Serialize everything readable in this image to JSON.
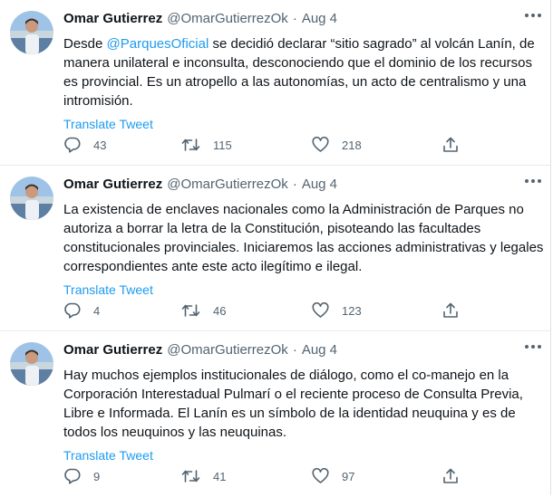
{
  "colors": {
    "accent": "#1d9bf0",
    "text": "#0f1419",
    "secondary": "#536471"
  },
  "icons": {
    "reply": "reply-icon",
    "retweet": "retweet-icon",
    "like": "like-icon",
    "share": "share-icon",
    "more": "more-icon"
  },
  "tweets": [
    {
      "name": "Omar Gutierrez",
      "handle": "@OmarGutierrezOk",
      "sep": "·",
      "date": "Aug 4",
      "text_before": "Desde ",
      "mention": "@ParquesOficial",
      "text_after": " se decidió declarar “sitio sagrado” al volcán Lanín, de manera unilateral e inconsulta, desconociendo que el dominio de los recursos es provincial. Es un atropello a las autonomías, un acto de centralismo y una intromisión.",
      "translate": "Translate Tweet",
      "replies": "43",
      "retweets": "115",
      "likes": "218"
    },
    {
      "name": "Omar Gutierrez",
      "handle": "@OmarGutierrezOk",
      "sep": "·",
      "date": "Aug 4",
      "text": "La existencia de enclaves nacionales como la Administración de Parques no autoriza a borrar la letra de la Constitución, pisoteando las facultades constitucionales provinciales. Iniciaremos las acciones administrativas y legales correspondientes ante este acto ilegítimo e ilegal.",
      "translate": "Translate Tweet",
      "replies": "4",
      "retweets": "46",
      "likes": "123"
    },
    {
      "name": "Omar Gutierrez",
      "handle": "@OmarGutierrezOk",
      "sep": "·",
      "date": "Aug 4",
      "text": "Hay muchos ejemplos institucionales de diálogo, como el co-manejo en la Corporación Interestadual Pulmarí o el reciente proceso de Consulta Previa, Libre e Informada. El Lanín es un símbolo de la identidad neuquina y es de todos los neuquinos y las neuquinas.",
      "translate": "Translate Tweet",
      "replies": "9",
      "retweets": "41",
      "likes": "97"
    }
  ]
}
